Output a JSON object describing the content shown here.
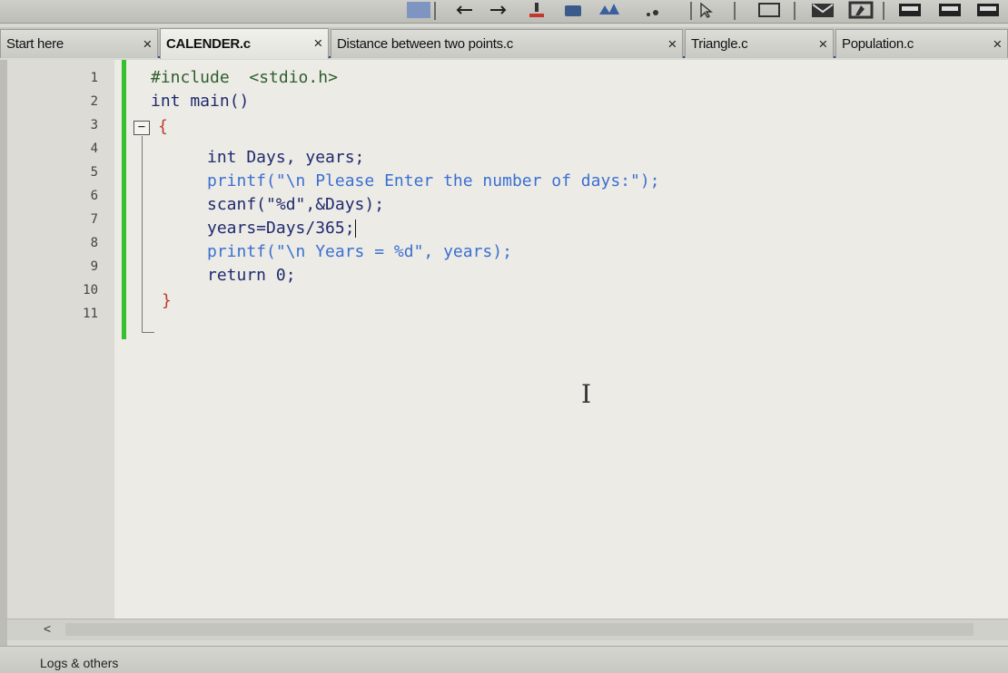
{
  "tabs": [
    {
      "label": "Start here",
      "close": "×",
      "active": false
    },
    {
      "label": "CALENDER.c",
      "close": "×",
      "active": true
    },
    {
      "label": "Distance between two points.c",
      "close": "×",
      "active": false
    },
    {
      "label": "Triangle.c",
      "close": "×",
      "active": false
    },
    {
      "label": "Population.c",
      "close": "×",
      "active": false
    }
  ],
  "editor": {
    "line_numbers": [
      "1",
      "2",
      "3",
      "4",
      "5",
      "6",
      "7",
      "8",
      "9",
      "10",
      "11"
    ],
    "fold_marker": "−",
    "lines": [
      "#include  <stdio.h>",
      "int main()",
      "{",
      "int Days, years;",
      "printf(\"\\n Please Enter the number of days:\");",
      "scanf(\"%d\",&Days);",
      "years=Days/365;",
      "printf(\"\\n Years = %d\", years);",
      "return 0;",
      "}",
      ""
    ]
  },
  "scrollbar": {
    "left_arrow": "<"
  },
  "bottom_panel": {
    "label": "Logs & others"
  },
  "colors": {
    "tab_underline": "#2d4f86",
    "change_bar": "#34c12d",
    "string": "#3b6fd1",
    "number": "#d0689a"
  }
}
